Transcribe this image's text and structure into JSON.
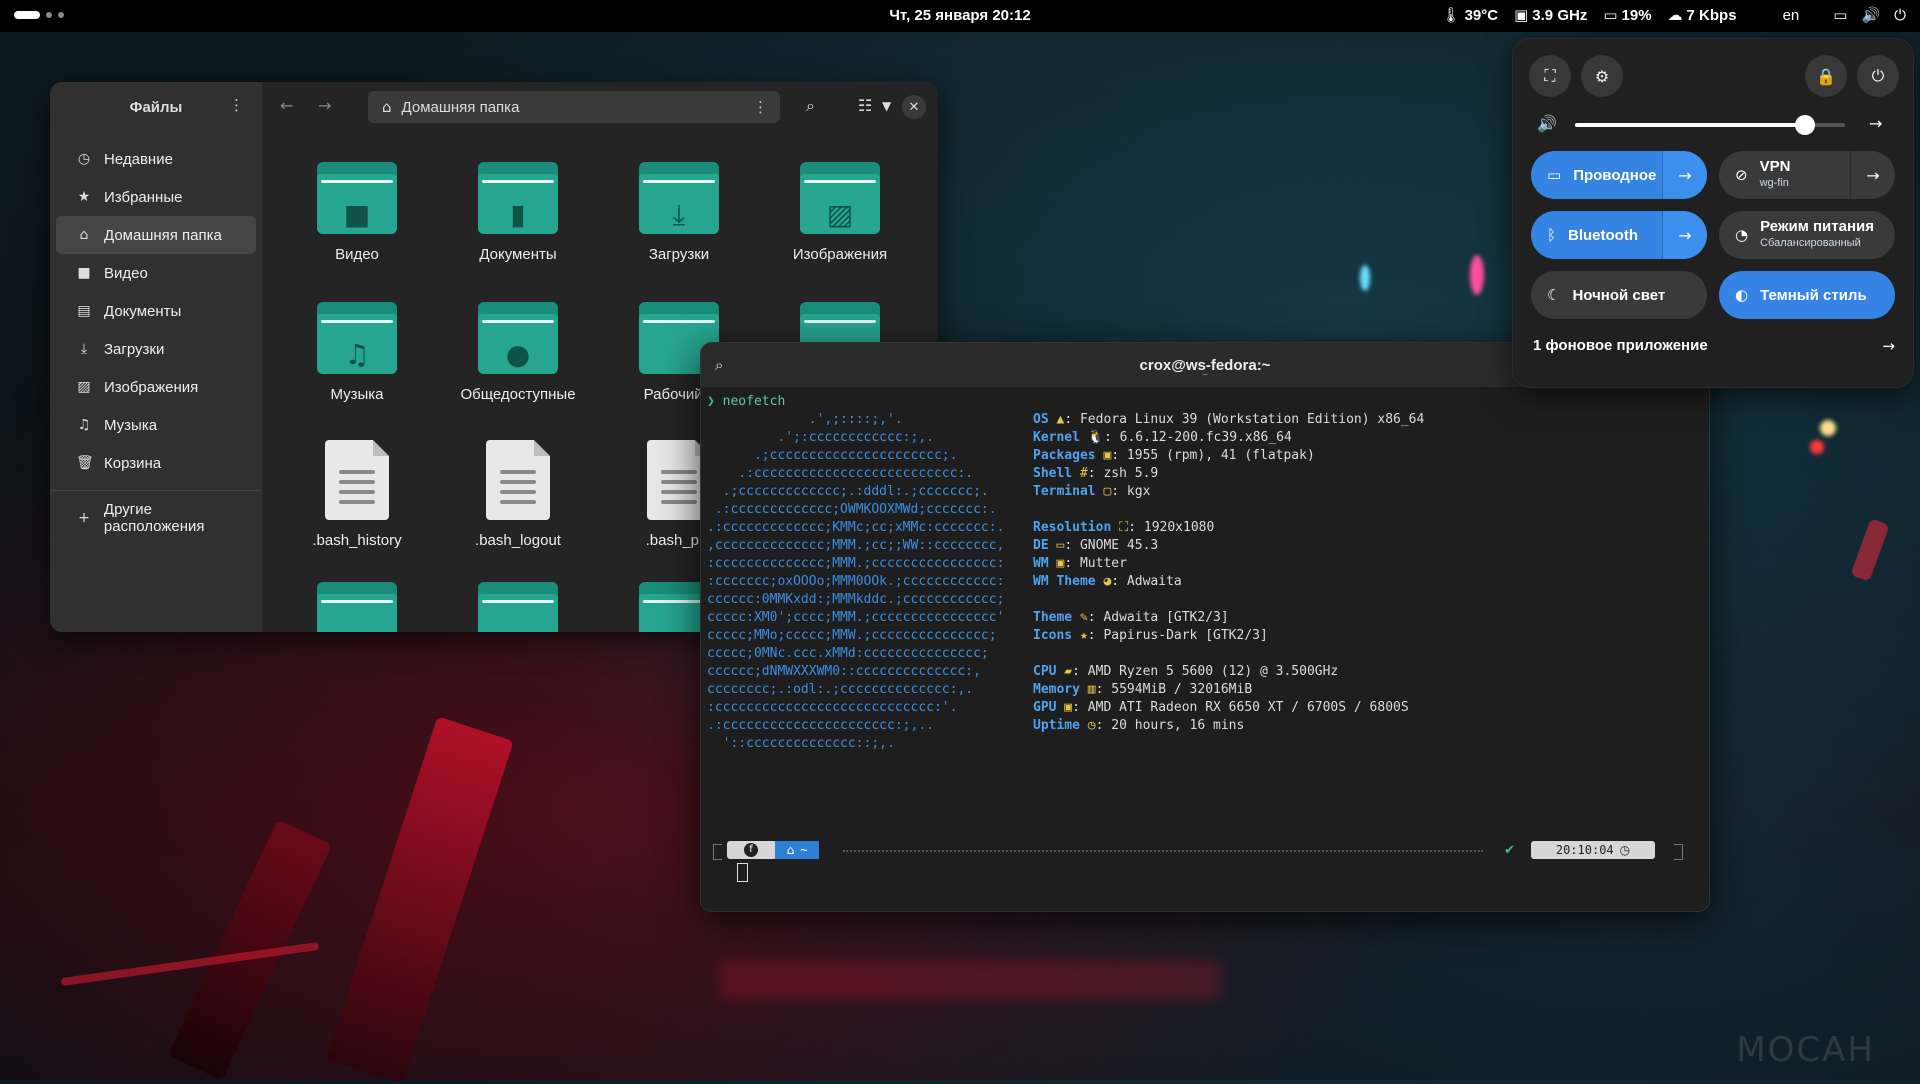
{
  "topbar": {
    "clock": "Чт, 25 января  20:12",
    "temp": "39°C",
    "cpu_freq": "3.9 GHz",
    "battery": "19%",
    "net_speed": "7 Kbps",
    "keyboard_layout": "en"
  },
  "files": {
    "title": "Файлы",
    "path": "Домашняя папка",
    "sidebar": {
      "items": [
        {
          "label": "Недавние",
          "icon": "clock-icon"
        },
        {
          "label": "Избранные",
          "icon": "star-icon"
        },
        {
          "label": "Домашняя папка",
          "icon": "home-icon"
        },
        {
          "label": "Видео",
          "icon": "video-icon"
        },
        {
          "label": "Документы",
          "icon": "document-icon"
        },
        {
          "label": "Загрузки",
          "icon": "download-icon"
        },
        {
          "label": "Изображения",
          "icon": "image-icon"
        },
        {
          "label": "Музыка",
          "icon": "music-icon"
        },
        {
          "label": "Корзина",
          "icon": "trash-icon"
        }
      ],
      "other_locations": "Другие расположения"
    },
    "grid": [
      {
        "label": "Видео",
        "type": "folder",
        "icon": "video-icon"
      },
      {
        "label": "Документы",
        "type": "folder",
        "icon": "document-icon"
      },
      {
        "label": "Загрузки",
        "type": "folder",
        "icon": "download-icon"
      },
      {
        "label": "Изображения",
        "type": "folder",
        "icon": "image-icon"
      },
      {
        "label": "Музыка",
        "type": "folder",
        "icon": "music-icon"
      },
      {
        "label": "Общедоступные",
        "type": "folder",
        "icon": "user-icon"
      },
      {
        "label": "Рабочий с",
        "type": "folder",
        "icon": ""
      },
      {
        "label": "",
        "type": "folder",
        "icon": "template-icon"
      },
      {
        "label": ".bash_history",
        "type": "file"
      },
      {
        "label": ".bash_logout",
        "type": "file"
      },
      {
        "label": ".bash_pro",
        "type": "file"
      }
    ]
  },
  "terminal": {
    "title": "crox@ws-fedora:~",
    "subtitle": "~",
    "prompt_symbol": "❯",
    "command": "neofetch",
    "ascii": [
      "             .',;::::;,'.",
      "         .';:cccccccccccc:;,.",
      "      .;cccccccccccccccccccccc;.",
      "    .:cccccccccccccccccccccccccc:.",
      "  .;ccccccccccccc;.:dddl:.;ccccccc;.",
      " .:ccccccccccccc;OWMKOOXMWd;ccccccc:.",
      ".:ccccccccccccc;KMMc;cc;xMMc:ccccccc:.",
      ",cccccccccccccc;MMM.;cc;;WW::cccccccc,",
      ":cccccccccccccc;MMM.;cccccccccccccccc:",
      ":ccccccc;oxOOOo;MMM0OOk.;cccccccccccc:",
      "cccccc:0MMKxdd:;MMMkddc.;cccccccccccc;",
      "ccccc:XM0';cccc;MMM.;cccccccccccccccc'",
      "ccccc;MMo;ccccc;MMW.;ccccccccccccccc;",
      "ccccc;0MNc.ccc.xMMd:ccccccccccccccc;",
      "cccccc;dNMWXXXWM0::cccccccccccccc:,",
      "cccccccc;.:odl:.;cccccccccccccc:,.",
      ":cccccccccccccccccccccccccccc:'.",
      ".:cccccccccccccccccccccc:;,..",
      "  '::cccccccccccccc::;,."
    ],
    "info": [
      {
        "key": "OS",
        "icon": "▲",
        "value": ": Fedora Linux 39 (Workstation Edition) x86_64"
      },
      {
        "key": "Kernel",
        "icon": "🐧",
        "value": ": 6.6.12-200.fc39.x86_64"
      },
      {
        "key": "Packages",
        "icon": "▣",
        "value": ": 1955 (rpm), 41 (flatpak)"
      },
      {
        "key": "Shell",
        "icon": "#",
        "value": ": zsh 5.9"
      },
      {
        "key": "Terminal",
        "icon": "▢",
        "value": ": kgx"
      },
      {
        "key": "",
        "icon": "",
        "value": ""
      },
      {
        "key": "Resolution",
        "icon": "⛶",
        "value": ": 1920x1080"
      },
      {
        "key": "DE",
        "icon": "▭",
        "value": ": GNOME 45.3"
      },
      {
        "key": "WM",
        "icon": "▣",
        "value": ": Mutter"
      },
      {
        "key": "WM Theme",
        "icon": "◕",
        "value": ": Adwaita"
      },
      {
        "key": "",
        "icon": "",
        "value": ""
      },
      {
        "key": "Theme",
        "icon": "✎",
        "value": ": Adwaita [GTK2/3]"
      },
      {
        "key": "Icons",
        "icon": "★",
        "value": ": Papirus-Dark [GTK2/3]"
      },
      {
        "key": "",
        "icon": "",
        "value": ""
      },
      {
        "key": "CPU",
        "icon": "▰",
        "value": ": AMD Ryzen 5 5600 (12) @ 3.500GHz"
      },
      {
        "key": "Memory",
        "icon": "▥",
        "value": ": 5594MiB / 32016MiB"
      },
      {
        "key": "GPU",
        "icon": "▣",
        "value": ": AMD ATI Radeon RX 6650 XT / 6700S / 6800S"
      },
      {
        "key": "Uptime",
        "icon": "◷",
        "value": ": 20 hours, 16 mins"
      }
    ],
    "prompt_bar": {
      "path": "~",
      "time": "20:10:04"
    }
  },
  "quick_settings": {
    "volume_level": 0.85,
    "tiles": [
      {
        "label": "Проводное",
        "sub": "",
        "on": true,
        "arrow": true,
        "icon": "ethernet-icon"
      },
      {
        "label": "VPN",
        "sub": "wg-fin",
        "on": false,
        "arrow": true,
        "icon": "vpn-off-icon"
      },
      {
        "label": "Bluetooth",
        "sub": "",
        "on": true,
        "arrow": true,
        "icon": "bluetooth-icon"
      },
      {
        "label": "Режим питания",
        "sub": "Сбалансированный",
        "on": false,
        "arrow": false,
        "icon": "power-profile-icon"
      },
      {
        "label": "Ночной свет",
        "sub": "",
        "on": false,
        "arrow": false,
        "icon": "moon-icon"
      },
      {
        "label": "Темный стиль",
        "sub": "",
        "on": true,
        "arrow": false,
        "icon": "dark-style-icon"
      }
    ],
    "background_apps": "1 фоновое приложение"
  },
  "watermark": "MOCAH",
  "colors": {
    "accent": "#3584e4",
    "folder": "#26a691",
    "terminal_key": "#4fa3ef",
    "ascii": "#3b8ee4"
  }
}
